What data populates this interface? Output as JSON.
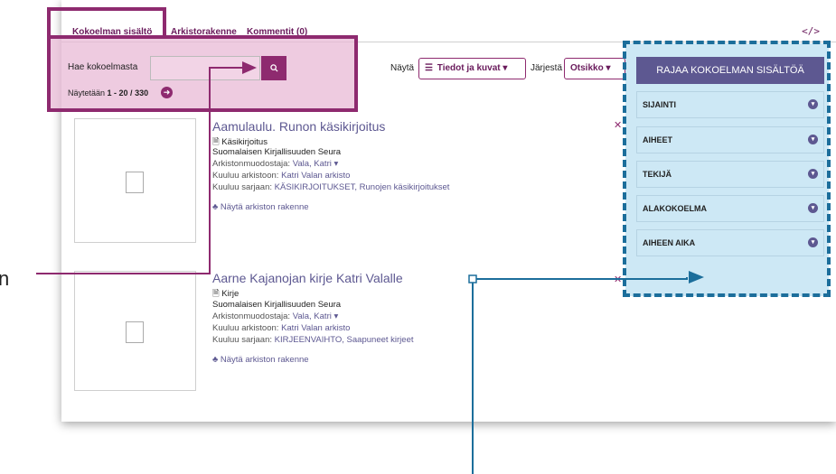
{
  "tabs": [
    {
      "label": "Kokoelman sisältö",
      "active": true
    },
    {
      "label": "Arkistorakenne",
      "active": false
    },
    {
      "label": "Kommentit (0)",
      "active": false
    }
  ],
  "code_icon": "</>",
  "search": {
    "label": "Hae kokoelmasta",
    "value": "",
    "button_icon": "search-icon"
  },
  "results": {
    "prefix": "Näytetään",
    "range": "1 - 20 / 330"
  },
  "view": {
    "label": "Näytä",
    "select": "Tiedot ja kuvat"
  },
  "sort": {
    "label": "Järjestä",
    "select": "Otsikko"
  },
  "facets": {
    "header": "RAJAA KOKOELMAN SISÄLTÖÄ",
    "items": [
      "SIJAINTI",
      "AIHEET",
      "TEKIJÄ",
      "ALAKOKOELMA",
      "AIHEEN AIKA"
    ]
  },
  "records": [
    {
      "title": "Aamulaulu. Runon käsikirjoitus",
      "format": "Käsikirjoitus",
      "org": "Suomalaisen Kirjallisuuden Seura",
      "creator_label": "Arkistonmuodostaja:",
      "creator": "Vala, Katri",
      "archive_label": "Kuuluu arkistoon:",
      "archive": "Katri Valan arkisto",
      "series_label": "Kuuluu sarjaan:",
      "series": "KÄSIKIRJOITUKSET, Runojen käsikirjoitukset",
      "tree": "Näytä arkiston rakenne"
    },
    {
      "title": "Aarne Kajanojan kirje Katri Valalle",
      "format": "Kirje",
      "org": "Suomalaisen Kirjallisuuden Seura",
      "creator_label": "Arkistonmuodostaja:",
      "creator": "Vala, Katri",
      "archive_label": "Kuuluu arkistoon:",
      "archive": "Katri Valan arkisto",
      "series_label": "Kuuluu sarjaan:",
      "series": "KIRJEENVAIHTO, Saapuneet kirjeet",
      "tree": "Näytä arkiston rakenne"
    }
  ],
  "annotation_left_letter": "n",
  "colors": {
    "brand": "#8e2a6f",
    "facet_header": "#5d5891",
    "facet_bg": "#cde8f5",
    "highlight_border": "#1c6e9b",
    "pink_overlay": "#e8b9d6"
  }
}
